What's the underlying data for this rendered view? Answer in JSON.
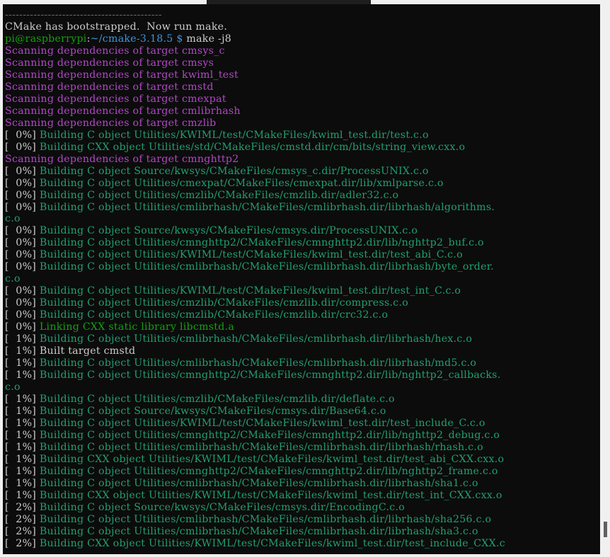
{
  "terminal": {
    "lines": [
      [
        {
          "t": "--------------------------------------------",
          "c": "c-dim"
        }
      ],
      [
        {
          "t": "CMake has bootstrapped.  Now run make.",
          "c": "c-default"
        }
      ],
      [
        {
          "t": "pi@raspberrypi",
          "c": "c-green"
        },
        {
          "t": ":",
          "c": "c-default"
        },
        {
          "t": "~/cmake-3.18.5 $",
          "c": "c-blue"
        },
        {
          "t": " make -j8",
          "c": "c-default"
        }
      ],
      [
        {
          "t": "Scanning dependencies of target cmsys_c",
          "c": "c-magenta"
        }
      ],
      [
        {
          "t": "Scanning dependencies of target cmsys",
          "c": "c-magenta"
        }
      ],
      [
        {
          "t": "Scanning dependencies of target kwiml_test",
          "c": "c-magenta"
        }
      ],
      [
        {
          "t": "Scanning dependencies of target cmstd",
          "c": "c-magenta"
        }
      ],
      [
        {
          "t": "Scanning dependencies of target cmexpat",
          "c": "c-magenta"
        }
      ],
      [
        {
          "t": "Scanning dependencies of target cmlibrhash",
          "c": "c-magenta"
        }
      ],
      [
        {
          "t": "Scanning dependencies of target cmzlib",
          "c": "c-magenta"
        }
      ],
      [
        {
          "t": "[  0%] ",
          "c": "c-default"
        },
        {
          "t": "Building C object Utilities/KWIML/test/CMakeFiles/kwiml_test.dir/test.c.o",
          "c": "c-build"
        }
      ],
      [
        {
          "t": "[  0%] ",
          "c": "c-default"
        },
        {
          "t": "Building CXX object Utilities/std/CMakeFiles/cmstd.dir/cm/bits/string_view.cxx.o",
          "c": "c-build"
        }
      ],
      [
        {
          "t": "Scanning dependencies of target cmnghttp2",
          "c": "c-magenta"
        }
      ],
      [
        {
          "t": "[  0%] ",
          "c": "c-default"
        },
        {
          "t": "Building C object Source/kwsys/CMakeFiles/cmsys_c.dir/ProcessUNIX.c.o",
          "c": "c-build"
        }
      ],
      [
        {
          "t": "[  0%] ",
          "c": "c-default"
        },
        {
          "t": "Building C object Utilities/cmexpat/CMakeFiles/cmexpat.dir/lib/xmlparse.c.o",
          "c": "c-build"
        }
      ],
      [
        {
          "t": "[  0%] ",
          "c": "c-default"
        },
        {
          "t": "Building C object Utilities/cmzlib/CMakeFiles/cmzlib.dir/adler32.c.o",
          "c": "c-build"
        }
      ],
      [
        {
          "t": "[  0%] ",
          "c": "c-default"
        },
        {
          "t": "Building C object Utilities/cmlibrhash/CMakeFiles/cmlibrhash.dir/librhash/algorithms.",
          "c": "c-build"
        }
      ],
      [
        {
          "t": "c.o",
          "c": "c-build"
        }
      ],
      [
        {
          "t": "[  0%] ",
          "c": "c-default"
        },
        {
          "t": "Building C object Source/kwsys/CMakeFiles/cmsys.dir/ProcessUNIX.c.o",
          "c": "c-build"
        }
      ],
      [
        {
          "t": "[  0%] ",
          "c": "c-default"
        },
        {
          "t": "Building C object Utilities/cmnghttp2/CMakeFiles/cmnghttp2.dir/lib/nghttp2_buf.c.o",
          "c": "c-build"
        }
      ],
      [
        {
          "t": "[  0%] ",
          "c": "c-default"
        },
        {
          "t": "Building C object Utilities/KWIML/test/CMakeFiles/kwiml_test.dir/test_abi_C.c.o",
          "c": "c-build"
        }
      ],
      [
        {
          "t": "[  0%] ",
          "c": "c-default"
        },
        {
          "t": "Building C object Utilities/cmlibrhash/CMakeFiles/cmlibrhash.dir/librhash/byte_order.",
          "c": "c-build"
        }
      ],
      [
        {
          "t": "c.o",
          "c": "c-build"
        }
      ],
      [
        {
          "t": "[  0%] ",
          "c": "c-default"
        },
        {
          "t": "Building C object Utilities/KWIML/test/CMakeFiles/kwiml_test.dir/test_int_C.c.o",
          "c": "c-build"
        }
      ],
      [
        {
          "t": "[  0%] ",
          "c": "c-default"
        },
        {
          "t": "Building C object Utilities/cmzlib/CMakeFiles/cmzlib.dir/compress.c.o",
          "c": "c-build"
        }
      ],
      [
        {
          "t": "[  0%] ",
          "c": "c-default"
        },
        {
          "t": "Building C object Utilities/cmzlib/CMakeFiles/cmzlib.dir/crc32.c.o",
          "c": "c-build"
        }
      ],
      [
        {
          "t": "[  0%] ",
          "c": "c-default"
        },
        {
          "t": "Linking CXX static library libcmstd.a",
          "c": "c-green"
        }
      ],
      [
        {
          "t": "[  1%] ",
          "c": "c-default"
        },
        {
          "t": "Building C object Utilities/cmlibrhash/CMakeFiles/cmlibrhash.dir/librhash/hex.c.o",
          "c": "c-build"
        }
      ],
      [
        {
          "t": "[  1%] Built target cmstd",
          "c": "c-default"
        }
      ],
      [
        {
          "t": "[  1%] ",
          "c": "c-default"
        },
        {
          "t": "Building C object Utilities/cmlibrhash/CMakeFiles/cmlibrhash.dir/librhash/md5.c.o",
          "c": "c-build"
        }
      ],
      [
        {
          "t": "[  1%] ",
          "c": "c-default"
        },
        {
          "t": "Building C object Utilities/cmnghttp2/CMakeFiles/cmnghttp2.dir/lib/nghttp2_callbacks.",
          "c": "c-build"
        }
      ],
      [
        {
          "t": "c.o",
          "c": "c-build"
        }
      ],
      [
        {
          "t": "[  1%] ",
          "c": "c-default"
        },
        {
          "t": "Building C object Utilities/cmzlib/CMakeFiles/cmzlib.dir/deflate.c.o",
          "c": "c-build"
        }
      ],
      [
        {
          "t": "[  1%] ",
          "c": "c-default"
        },
        {
          "t": "Building C object Source/kwsys/CMakeFiles/cmsys.dir/Base64.c.o",
          "c": "c-build"
        }
      ],
      [
        {
          "t": "[  1%] ",
          "c": "c-default"
        },
        {
          "t": "Building C object Utilities/KWIML/test/CMakeFiles/kwiml_test.dir/test_include_C.c.o",
          "c": "c-build"
        }
      ],
      [
        {
          "t": "[  1%] ",
          "c": "c-default"
        },
        {
          "t": "Building C object Utilities/cmnghttp2/CMakeFiles/cmnghttp2.dir/lib/nghttp2_debug.c.o",
          "c": "c-build"
        }
      ],
      [
        {
          "t": "[  1%] ",
          "c": "c-default"
        },
        {
          "t": "Building C object Utilities/cmlibrhash/CMakeFiles/cmlibrhash.dir/librhash/rhash.c.o",
          "c": "c-build"
        }
      ],
      [
        {
          "t": "[  1%] ",
          "c": "c-default"
        },
        {
          "t": "Building CXX object Utilities/KWIML/test/CMakeFiles/kwiml_test.dir/test_abi_CXX.cxx.o",
          "c": "c-build"
        }
      ],
      [
        {
          "t": "[  1%] ",
          "c": "c-default"
        },
        {
          "t": "Building C object Utilities/cmnghttp2/CMakeFiles/cmnghttp2.dir/lib/nghttp2_frame.c.o",
          "c": "c-build"
        }
      ],
      [
        {
          "t": "[  1%] ",
          "c": "c-default"
        },
        {
          "t": "Building C object Utilities/cmlibrhash/CMakeFiles/cmlibrhash.dir/librhash/sha1.c.o",
          "c": "c-build"
        }
      ],
      [
        {
          "t": "[  1%] ",
          "c": "c-default"
        },
        {
          "t": "Building CXX object Utilities/KWIML/test/CMakeFiles/kwiml_test.dir/test_int_CXX.cxx.o",
          "c": "c-build"
        }
      ],
      [
        {
          "t": "[  2%] ",
          "c": "c-default"
        },
        {
          "t": "Building C object Source/kwsys/CMakeFiles/cmsys.dir/EncodingC.c.o",
          "c": "c-build"
        }
      ],
      [
        {
          "t": "[  2%] ",
          "c": "c-default"
        },
        {
          "t": "Building C object Utilities/cmlibrhash/CMakeFiles/cmlibrhash.dir/librhash/sha256.c.o",
          "c": "c-build"
        }
      ],
      [
        {
          "t": "[  2%] ",
          "c": "c-default"
        },
        {
          "t": "Building C object Utilities/cmlibrhash/CMakeFiles/cmlibrhash.dir/librhash/sha3.c.o",
          "c": "c-build"
        }
      ],
      [
        {
          "t": "[  2%] ",
          "c": "c-default"
        },
        {
          "t": "Building CXX object Utilities/KWIML/test/CMakeFiles/kwiml_test.dir/test_include_CXX.c",
          "c": "c-build"
        }
      ]
    ]
  }
}
